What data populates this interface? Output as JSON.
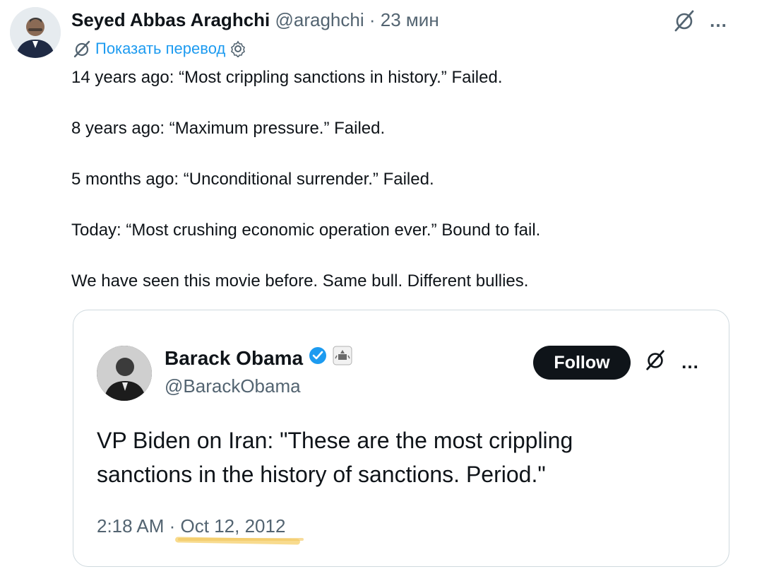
{
  "tweet": {
    "author_name": "Seyed Abbas Araghchi",
    "handle": "@araghchi",
    "separator": "·",
    "time": "23 мин",
    "translate_label": "Показать перевод",
    "lines": [
      "14 years ago: “Most crippling sanctions in history.” Failed.",
      "8 years ago: “Maximum pressure.” Failed.",
      "5 months ago: “Unconditional surrender.” Failed.",
      "Today: “Most crushing economic operation ever.” Bound to fail.",
      "We have seen this movie before. Same bull. Different bullies."
    ],
    "more_icon": "…"
  },
  "quote": {
    "author_name": "Barack Obama",
    "handle": "@BarackObama",
    "follow_label": "Follow",
    "text": "VP Biden on Iran: \"These are the most crippling sanctions in the history of sanctions. Period.\"",
    "time": "2:18 AM",
    "separator": "·",
    "date": "Oct 12, 2012",
    "more_icon": "…"
  },
  "colors": {
    "link_blue": "#1d9bf0",
    "muted_gray": "#536471",
    "border": "#cfd9de",
    "highlight_yellow": "#f7d57a"
  }
}
